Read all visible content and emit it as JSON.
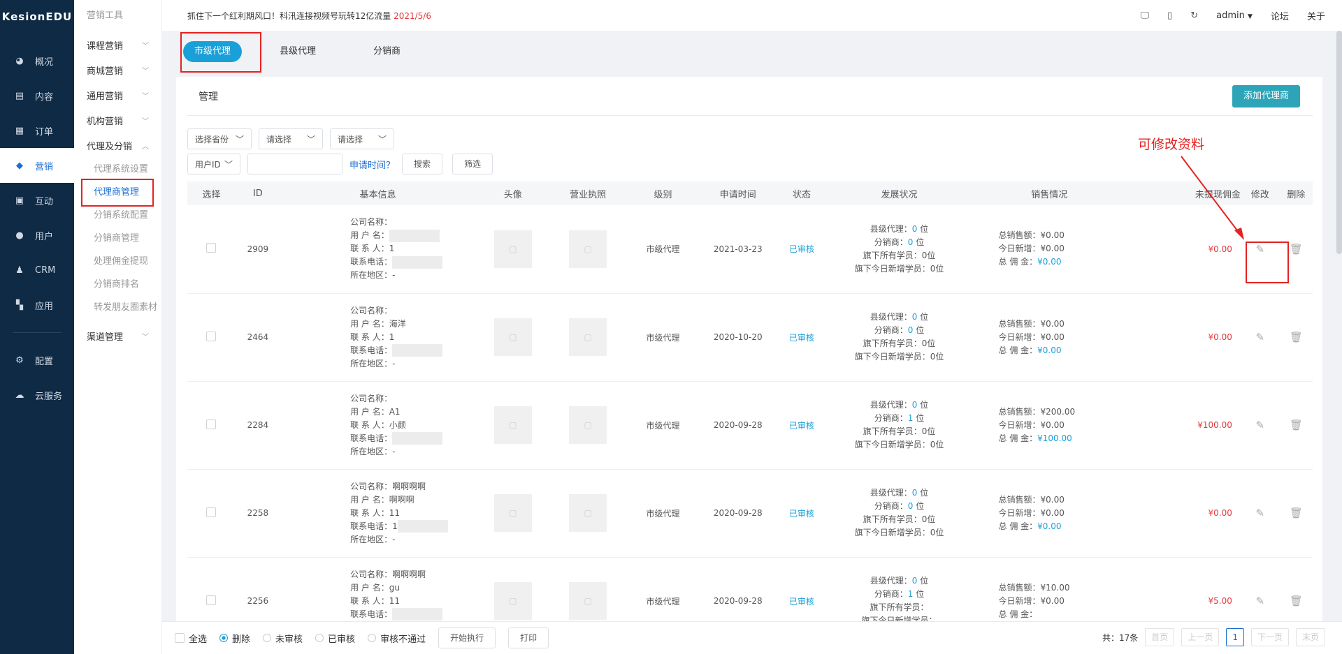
{
  "nav": {
    "logo": "KesionEDU",
    "items": [
      {
        "label": "概况",
        "icon": "dashboard-icon"
      },
      {
        "label": "内容",
        "icon": "content-icon"
      },
      {
        "label": "订单",
        "icon": "order-icon"
      },
      {
        "label": "营销",
        "icon": "marketing-icon",
        "active": true
      },
      {
        "label": "互动",
        "icon": "chat-icon"
      },
      {
        "label": "用户",
        "icon": "user-icon"
      },
      {
        "label": "CRM",
        "icon": "crm-icon"
      },
      {
        "label": "应用",
        "icon": "apps-icon"
      }
    ],
    "bottom_items": [
      {
        "label": "配置",
        "icon": "settings-icon"
      },
      {
        "label": "云服务",
        "icon": "cloud-icon"
      }
    ]
  },
  "submenu": {
    "head": "营销工具",
    "groups": [
      "课程营销",
      "商城营销",
      "通用营销",
      "机构营销",
      "代理及分销"
    ],
    "children": [
      "代理系统设置",
      "代理商管理",
      "分销系统配置",
      "分销商管理",
      "处理佣金提现",
      "分销商排名",
      "转发朋友圈素材"
    ],
    "last_group": "渠道管理"
  },
  "topbar": {
    "notice": "抓住下一个红利期风口！科汛连接视频号玩转12亿流量 ",
    "notice_date": "2021/5/6",
    "user": "admin",
    "forum": "论坛",
    "about": "关于"
  },
  "tabs": [
    "市级代理",
    "县级代理",
    "分销商"
  ],
  "card": {
    "title": "管理",
    "add_button": "添加代理商"
  },
  "filters": {
    "province": "选择省份",
    "select1": "请选择",
    "select2": "请选择",
    "field": "用户ID",
    "apply_time": "申请时间？",
    "search": "搜索",
    "filter": "筛选"
  },
  "table": {
    "headers": [
      "选择",
      "ID",
      "基本信息",
      "头像",
      "营业执照",
      "级别",
      "申请时间",
      "状态",
      "发展状况",
      "销售情况",
      "未提现佣金",
      "修改",
      "删除"
    ],
    "labels": {
      "company": "公司名称：",
      "username": "用 户 名：",
      "contact": "联 系 人：",
      "phone": "联系电话：",
      "region": "所在地区：",
      "county": "县级代理：",
      "distributor": "分销商：",
      "students": "旗下所有学员：",
      "today_students": "旗下今日新增学员：",
      "total_sales": "总销售额：",
      "today_new": "今日新增：",
      "commission": "总 佣 金："
    },
    "rows": [
      {
        "id": "2909",
        "company": "",
        "username": "",
        "contact": "1",
        "phone": "",
        "region": "-",
        "level": "市级代理",
        "date": "2021-03-23",
        "status": "已审核",
        "county": "0",
        "distributor": "0",
        "students": "0位",
        "today_students": "0位",
        "total_sales": "¥0.00",
        "today_new": "¥0.00",
        "commission": "¥0.00",
        "unwithdrawn": "¥0.00"
      },
      {
        "id": "2464",
        "company": "",
        "username": "海洋",
        "contact": "1",
        "phone": "",
        "region": "-",
        "level": "市级代理",
        "date": "2020-10-20",
        "status": "已审核",
        "county": "0",
        "distributor": "0",
        "students": "0位",
        "today_students": "0位",
        "total_sales": "¥0.00",
        "today_new": "¥0.00",
        "commission": "¥0.00",
        "unwithdrawn": "¥0.00"
      },
      {
        "id": "2284",
        "company": "",
        "username": "A1",
        "contact": "小颜",
        "phone": "",
        "region": "-",
        "level": "市级代理",
        "date": "2020-09-28",
        "status": "已审核",
        "county": "0",
        "distributor": "1",
        "students": "0位",
        "today_students": "0位",
        "total_sales": "¥200.00",
        "today_new": "¥0.00",
        "commission": "¥100.00",
        "unwithdrawn": "¥100.00"
      },
      {
        "id": "2258",
        "company": "啊啊啊啊",
        "username": "啊啊啊",
        "contact": "11",
        "phone": "1",
        "region": "-",
        "level": "市级代理",
        "date": "2020-09-28",
        "status": "已审核",
        "county": "0",
        "distributor": "0",
        "students": "0位",
        "today_students": "0位",
        "total_sales": "¥0.00",
        "today_new": "¥0.00",
        "commission": "¥0.00",
        "unwithdrawn": "¥0.00"
      },
      {
        "id": "2256",
        "company": "啊啊啊啊",
        "username": "gu",
        "contact": "11",
        "phone": "",
        "region": "-",
        "level": "市级代理",
        "date": "2020-09-28",
        "status": "已审核",
        "county": "0",
        "distributor": "1",
        "students": "",
        "today_students": "",
        "total_sales": "¥10.00",
        "today_new": "¥0.00",
        "commission": "",
        "unwithdrawn": "¥5.00"
      }
    ],
    "unit": "位"
  },
  "annotation": "可修改资料",
  "bottom": {
    "select_all": "全选",
    "options": [
      "删除",
      "未审核",
      "已审核",
      "审核不通过"
    ],
    "execute": "开始执行",
    "print": "打印",
    "total": "共：17条",
    "first": "首页",
    "prev": "上一页",
    "page": "1",
    "next": "下一页",
    "last": "末页"
  },
  "colors": {
    "accent": "#1aa0d8",
    "nav_bg": "#0f2a45",
    "red": "#e4393c",
    "primary_button": "#2ea4b8"
  }
}
